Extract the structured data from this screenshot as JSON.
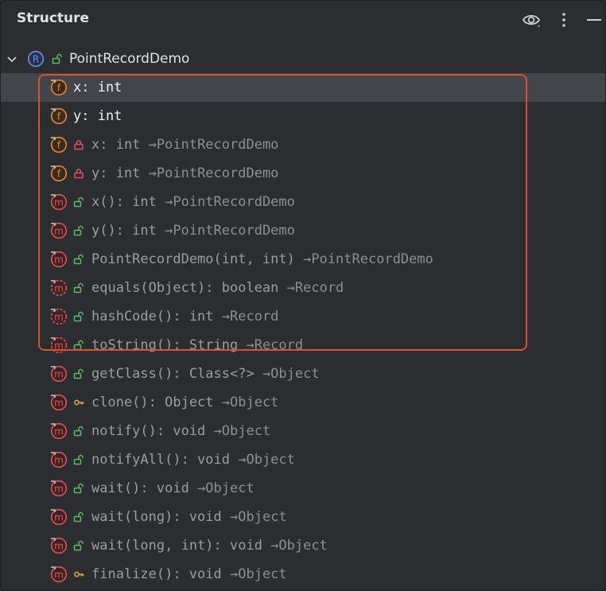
{
  "panel": {
    "title": "Structure"
  },
  "header_icons": [
    "eye-icon",
    "more-vertical-icon",
    "minimize-icon"
  ],
  "root": {
    "label": "PointRecordDemo",
    "icon": "record-icon",
    "access": "public"
  },
  "items": [
    {
      "label": "x: int",
      "type": "",
      "kind": "field",
      "access": "none",
      "overridden": false,
      "style": "bright",
      "selected": true
    },
    {
      "label": "y: int",
      "type": "",
      "kind": "field",
      "access": "none",
      "overridden": false,
      "style": "bright",
      "selected": false
    },
    {
      "label": "x: int ",
      "type": "→PointRecordDemo",
      "kind": "field",
      "access": "private",
      "overridden": false,
      "style": "dim",
      "selected": false
    },
    {
      "label": "y: int ",
      "type": "→PointRecordDemo",
      "kind": "field",
      "access": "private",
      "overridden": false,
      "style": "dim",
      "selected": false
    },
    {
      "label": "x(): int ",
      "type": "→PointRecordDemo",
      "kind": "method",
      "access": "public",
      "overridden": false,
      "style": "dim",
      "selected": false
    },
    {
      "label": "y(): int ",
      "type": "→PointRecordDemo",
      "kind": "method",
      "access": "public",
      "overridden": false,
      "style": "dim",
      "selected": false
    },
    {
      "label": "PointRecordDemo(int, int) ",
      "type": "→PointRecordDemo",
      "kind": "method",
      "access": "public",
      "overridden": false,
      "style": "dim",
      "selected": false
    },
    {
      "label": "equals(Object): boolean ",
      "type": "→Record",
      "kind": "method",
      "access": "public",
      "overridden": true,
      "style": "dim",
      "selected": false
    },
    {
      "label": "hashCode(): int ",
      "type": "→Record",
      "kind": "method",
      "access": "public",
      "overridden": true,
      "style": "dim",
      "selected": false
    },
    {
      "label": "toString(): String ",
      "type": "→Record",
      "kind": "method",
      "access": "public",
      "overridden": true,
      "style": "dim",
      "selected": false
    },
    {
      "label": "getClass(): Class<?> ",
      "type": "→Object",
      "kind": "method",
      "access": "public",
      "overridden": false,
      "style": "dim",
      "selected": false
    },
    {
      "label": "clone(): Object ",
      "type": "→Object",
      "kind": "method",
      "access": "protected",
      "overridden": false,
      "style": "dim",
      "selected": false
    },
    {
      "label": "notify(): void ",
      "type": "→Object",
      "kind": "method",
      "access": "public",
      "overridden": false,
      "style": "dim",
      "selected": false
    },
    {
      "label": "notifyAll(): void ",
      "type": "→Object",
      "kind": "method",
      "access": "public",
      "overridden": false,
      "style": "dim",
      "selected": false
    },
    {
      "label": "wait(): void ",
      "type": "→Object",
      "kind": "method",
      "access": "public",
      "overridden": false,
      "style": "dim",
      "selected": false
    },
    {
      "label": "wait(long): void ",
      "type": "→Object",
      "kind": "method",
      "access": "public",
      "overridden": false,
      "style": "dim",
      "selected": false
    },
    {
      "label": "wait(long, int): void ",
      "type": "→Object",
      "kind": "method",
      "access": "public",
      "overridden": false,
      "style": "dim",
      "selected": false
    },
    {
      "label": "finalize(): void ",
      "type": "→Object",
      "kind": "method",
      "access": "protected",
      "overridden": false,
      "style": "dim",
      "selected": false
    }
  ],
  "colors": {
    "background": "#2b2d30",
    "selected_row": "#43454a",
    "highlight_border": "#d9522b",
    "field_icon": "#e0873a",
    "method_icon": "#e05555",
    "record_icon": "#6e8fe8",
    "public_access": "#5fb865",
    "private_access": "#e05555",
    "protected_access": "#e0b43a"
  }
}
